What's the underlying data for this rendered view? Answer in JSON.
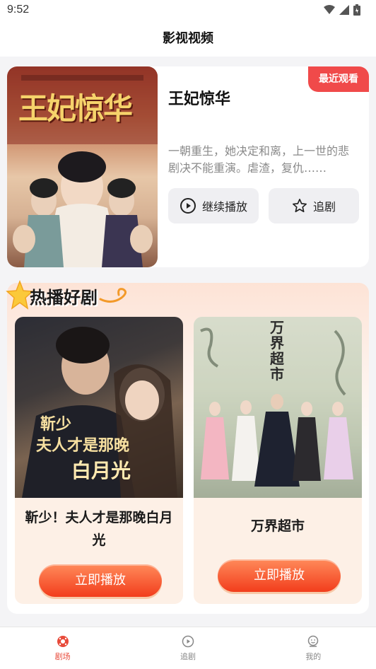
{
  "status": {
    "time": "9:52"
  },
  "header": {
    "title": "影视视频"
  },
  "recent": {
    "badge": "最近观看",
    "title": "王妃惊华",
    "description": "一朝重生，她决定和离，上一世的悲剧决不能重演。虐渣，复仇……",
    "poster_text": "王妃惊华",
    "continue_label": "继续播放",
    "follow_label": "追剧"
  },
  "hot": {
    "title": "热播好剧",
    "items": [
      {
        "name": "靳少！夫人才是那晚白月光",
        "poster_text_1": "靳少",
        "poster_text_2": "夫人才是那晚",
        "poster_text_3": "白月光",
        "play_label": "立即播放"
      },
      {
        "name": "万界超市",
        "poster_text": "万界超市",
        "play_label": "立即播放"
      }
    ]
  },
  "tabs": [
    {
      "label": "剧场",
      "icon": "theater-icon",
      "active": true
    },
    {
      "label": "追剧",
      "icon": "play-circle-icon",
      "active": false
    },
    {
      "label": "我的",
      "icon": "profile-icon",
      "active": false
    }
  ],
  "colors": {
    "accent": "#e84a3a",
    "badge": "#f04a4a",
    "play_button": "#f23d1c"
  }
}
